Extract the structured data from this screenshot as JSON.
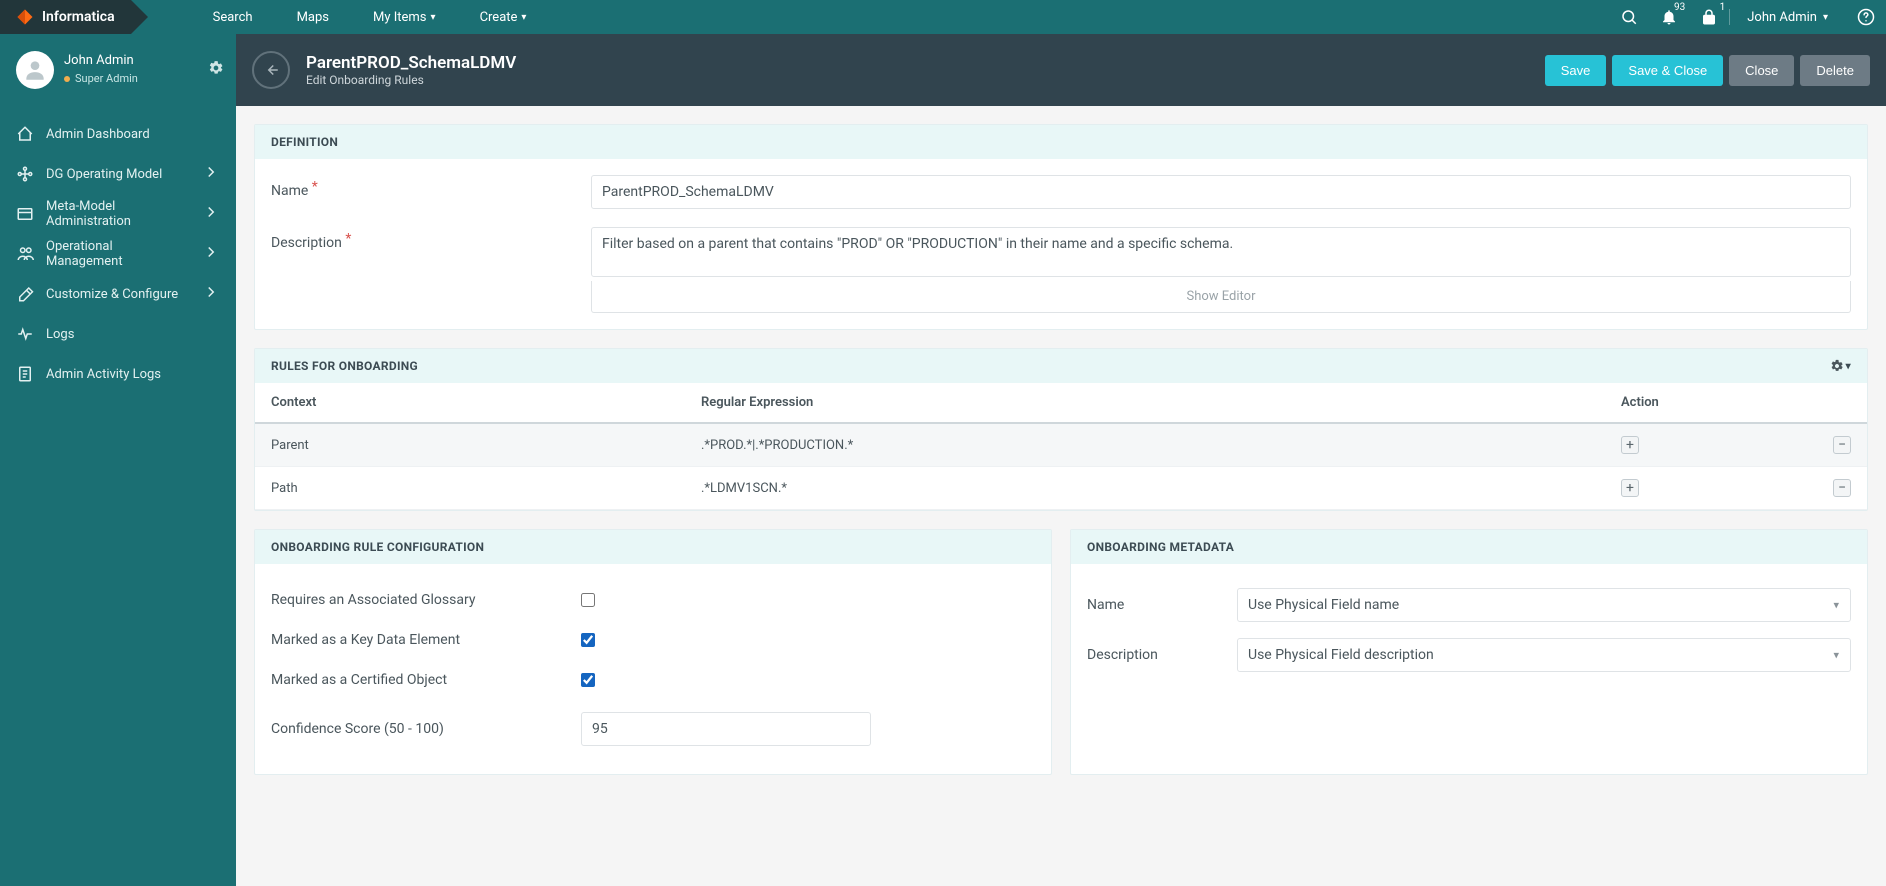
{
  "brand": "Informatica",
  "topnav": {
    "search": "Search",
    "maps": "Maps",
    "my_items": "My Items",
    "create": "Create"
  },
  "header_icons": {
    "notifications_count": "93",
    "lock_count": "1",
    "user": "John Admin"
  },
  "sidebar_user": {
    "name": "John Admin",
    "role": "Super Admin"
  },
  "sidebar": [
    {
      "key": "dashboard",
      "label": "Admin Dashboard",
      "chev": false
    },
    {
      "key": "dg-model",
      "label": "DG Operating Model",
      "chev": true
    },
    {
      "key": "meta-model",
      "label": "Meta-Model Administration",
      "chev": true
    },
    {
      "key": "ops-mgmt",
      "label": "Operational Management",
      "chev": true
    },
    {
      "key": "customize",
      "label": "Customize & Configure",
      "chev": true
    },
    {
      "key": "logs",
      "label": "Logs",
      "chev": false
    },
    {
      "key": "activity-logs",
      "label": "Admin Activity Logs",
      "chev": false
    }
  ],
  "page": {
    "title": "ParentPROD_SchemaLDMV",
    "subtitle": "Edit Onboarding Rules",
    "actions": {
      "save": "Save",
      "save_close": "Save & Close",
      "close": "Close",
      "delete": "Delete"
    }
  },
  "definition": {
    "heading": "DEFINITION",
    "name_label": "Name",
    "name_value": "ParentPROD_SchemaLDMV",
    "desc_label": "Description",
    "desc_value": "Filter based on a parent that contains \"PROD\" OR \"PRODUCTION\" in their name and a specific schema.",
    "show_editor": "Show Editor"
  },
  "rules": {
    "heading": "RULES FOR ONBOARDING",
    "cols": {
      "context": "Context",
      "regex": "Regular Expression",
      "action": "Action"
    },
    "rows": [
      {
        "context": "Parent",
        "regex": ".*PROD.*|.*PRODUCTION.*"
      },
      {
        "context": "Path",
        "regex": ".*LDMV1SCN.*"
      }
    ]
  },
  "config": {
    "heading": "ONBOARDING RULE CONFIGURATION",
    "glossary_label": "Requires an Associated Glossary",
    "glossary_checked": false,
    "kde_label": "Marked as a Key Data Element",
    "kde_checked": true,
    "certified_label": "Marked as a Certified Object",
    "certified_checked": true,
    "confidence_label": "Confidence Score (50 - 100)",
    "confidence_value": "95"
  },
  "metadata": {
    "heading": "ONBOARDING METADATA",
    "name_label": "Name",
    "name_value": "Use Physical Field name",
    "desc_label": "Description",
    "desc_value": "Use Physical Field description"
  }
}
